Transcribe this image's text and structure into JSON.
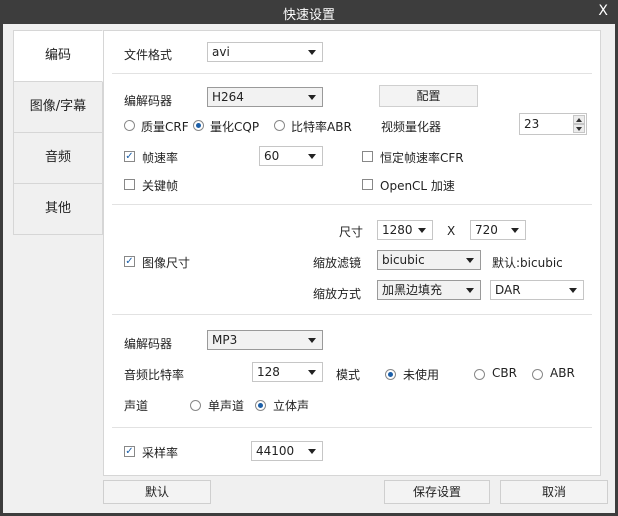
{
  "window": {
    "title": "快速设置",
    "close": "X"
  },
  "sidebar": {
    "tabs": [
      "编码",
      "图像/字幕",
      "音频",
      "其他"
    ]
  },
  "file": {
    "format_label": "文件格式",
    "format_value": "avi"
  },
  "video": {
    "codec_label": "编解码器",
    "codec_value": "H264",
    "config_button": "配置",
    "rate_modes": [
      "质量CRF",
      "量化CQP",
      "比特率ABR"
    ],
    "selected_mode": "量化CQP",
    "quantizer_label": "视频量化器",
    "quantizer_value": "23",
    "framerate_label": "帧速率",
    "framerate_checked": true,
    "framerate_value": "60",
    "cfr_label": "恒定帧速率CFR",
    "cfr_checked": false,
    "keyframe_label": "关键帧",
    "keyframe_checked": false,
    "opencl_label": "OpenCL 加速",
    "opencl_checked": false
  },
  "image": {
    "size_label": "图像尺寸",
    "size_checked": true,
    "dim_label": "尺寸",
    "width": "1280",
    "times": "X",
    "height": "720",
    "filter_label": "缩放滤镜",
    "filter_value": "bicubic",
    "filter_default": "默认:bicubic",
    "scale_mode_label": "缩放方式",
    "scale_mode_value": "加黑边填充",
    "aspect_value": "DAR"
  },
  "audio": {
    "codec_label": "编解码器",
    "codec_value": "MP3",
    "bitrate_label": "音频比特率",
    "bitrate_value": "128",
    "mode_label": "模式",
    "modes": [
      "未使用",
      "CBR",
      "ABR"
    ],
    "selected_mode": "未使用",
    "channel_label": "声道",
    "channels": [
      "单声道",
      "立体声"
    ],
    "selected_channel": "立体声",
    "samplerate_label": "采样率",
    "samplerate_checked": true,
    "samplerate_value": "44100"
  },
  "footer": {
    "default_button": "默认",
    "save_button": "保存设置",
    "cancel_button": "取消"
  }
}
